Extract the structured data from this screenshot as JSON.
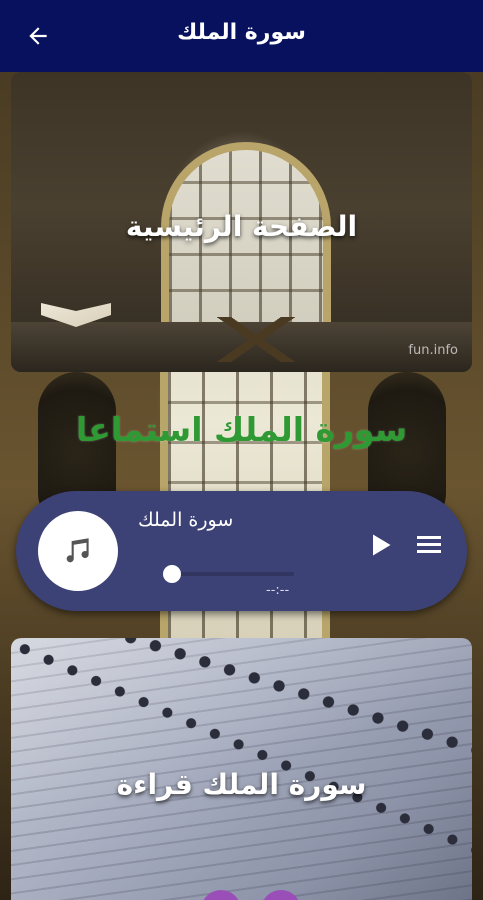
{
  "app_bar": {
    "title": "سورة الملك",
    "back_icon": "arrow-left-icon",
    "background": "#07115e"
  },
  "home_card": {
    "label": "الصفحة الرئيسية",
    "watermark": "fun.info"
  },
  "listen_section": {
    "heading": "سورة الملك استماعا",
    "heading_color": "#2f9a34"
  },
  "player": {
    "track_title": "سورة الملك",
    "time": "--:--",
    "progress": 0,
    "icons": {
      "artwork": "music-note-icon",
      "play": "play-icon",
      "menu": "menu-icon"
    },
    "background": "#3c4275"
  },
  "read_card": {
    "label": "سورة الملك قراءة"
  }
}
